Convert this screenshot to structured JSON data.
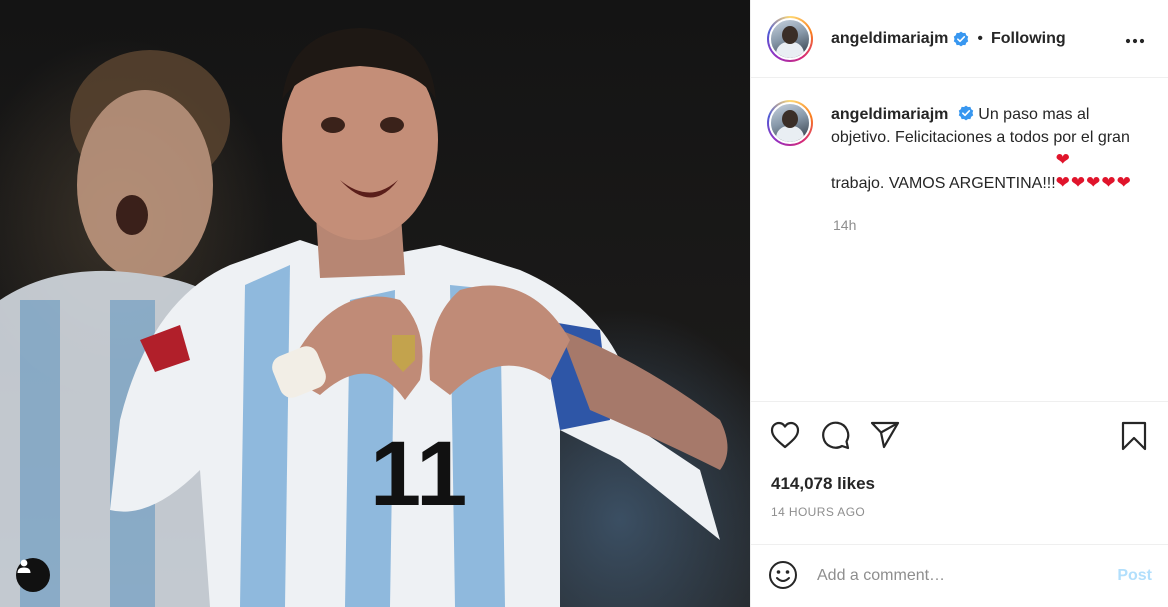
{
  "header": {
    "username": "angeldimariajm",
    "separator": "•",
    "follow_state": "Following"
  },
  "caption": {
    "username": "angeldimariajm",
    "text": "Un paso mas al objetivo. Felicitaciones a todos por el gran trabajo. VAMOS ARGENTINA!!!",
    "hearts": "❤\n❤❤❤❤❤",
    "relative_time": "14h"
  },
  "stats": {
    "likes": "414,078 likes",
    "posted_ago": "14 HOURS AGO"
  },
  "composer": {
    "placeholder": "Add a comment…",
    "post_label": "Post"
  },
  "media": {
    "jersey_number": "11"
  },
  "colors": {
    "verified": "#3897f0",
    "post_disabled": "#b2dffc",
    "heart": "#e0142b"
  },
  "icons": [
    "user-tag-icon",
    "verified-icon",
    "more-options-icon",
    "heart-icon",
    "comment-icon",
    "share-icon",
    "bookmark-icon",
    "emoji-icon"
  ]
}
